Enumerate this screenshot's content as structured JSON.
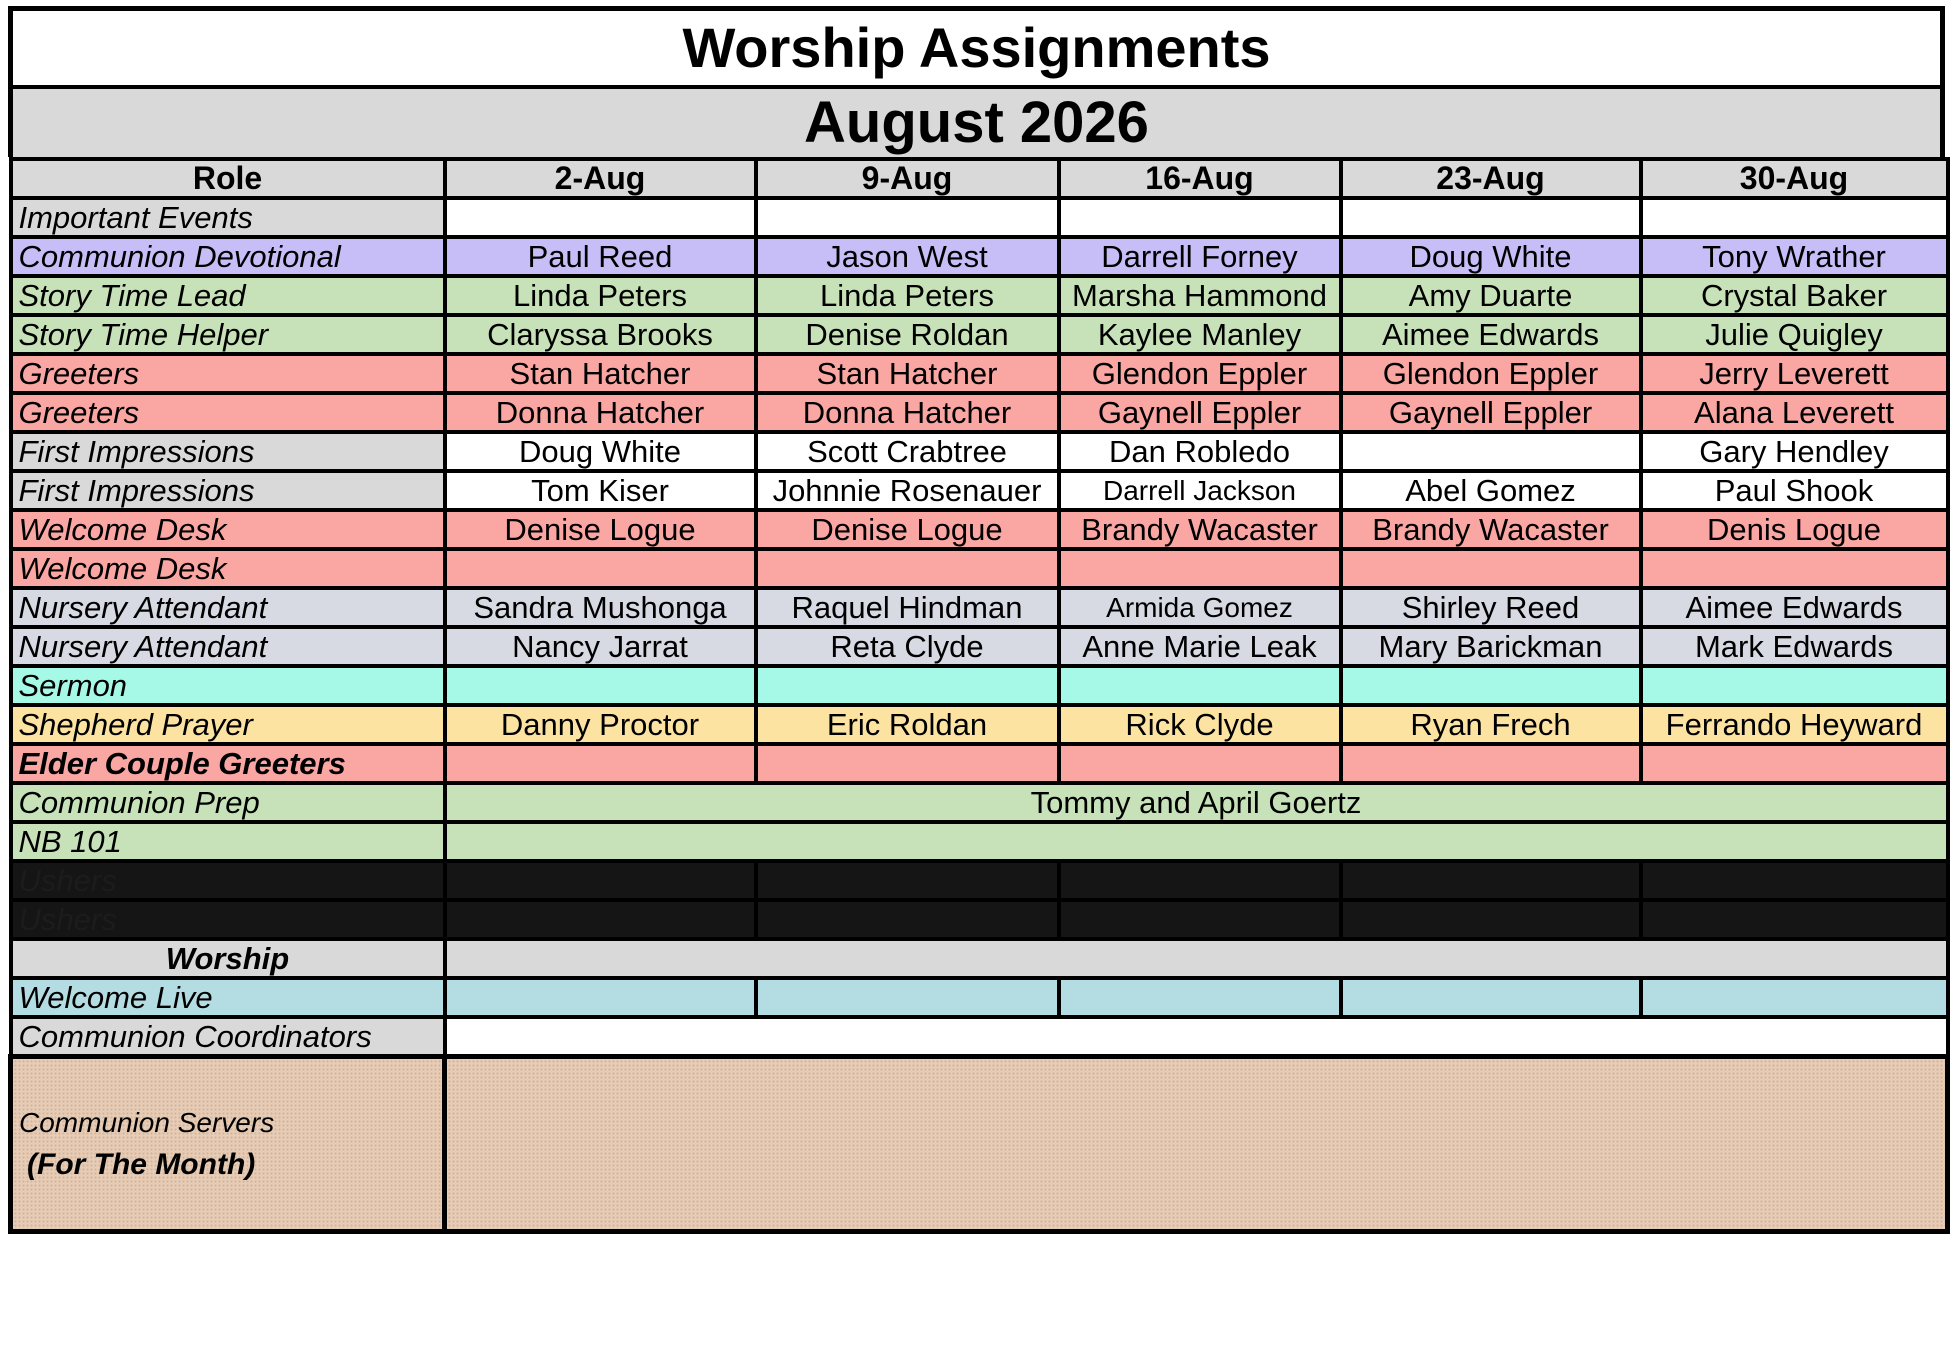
{
  "title": "Worship Assignments",
  "month": "August 2026",
  "header": {
    "role": "Role",
    "dates": [
      "2-Aug",
      "9-Aug",
      "16-Aug",
      "23-Aug",
      "30-Aug"
    ]
  },
  "rows": [
    {
      "role": "Important Events",
      "cells": [
        "",
        "",
        "",
        "",
        ""
      ]
    },
    {
      "role": "Communion Devotional",
      "cells": [
        "Paul Reed",
        "Jason West",
        "Darrell Forney",
        "Doug White",
        "Tony Wrather"
      ]
    },
    {
      "role": "Story Time Lead",
      "cells": [
        "Linda Peters",
        "Linda Peters",
        "Marsha Hammond",
        "Amy Duarte",
        "Crystal Baker"
      ]
    },
    {
      "role": "Story Time Helper",
      "cells": [
        "Claryssa Brooks",
        "Denise Roldan",
        "Kaylee Manley",
        "Aimee Edwards",
        "Julie Quigley"
      ]
    },
    {
      "role": "Greeters",
      "cells": [
        "Stan Hatcher",
        "Stan Hatcher",
        "Glendon Eppler",
        "Glendon Eppler",
        "Jerry Leverett"
      ]
    },
    {
      "role": "Greeters",
      "cells": [
        "Donna Hatcher",
        "Donna Hatcher",
        "Gaynell Eppler",
        "Gaynell Eppler",
        "Alana Leverett"
      ]
    },
    {
      "role": "First Impressions",
      "cells": [
        "Doug White",
        "Scott Crabtree",
        "Dan Robledo",
        "",
        "Gary Hendley"
      ]
    },
    {
      "role": "First Impressions",
      "cells": [
        "Tom Kiser",
        "Johnnie Rosenauer",
        "Darrell Jackson",
        "Abel Gomez",
        "Paul Shook"
      ]
    },
    {
      "role": "Welcome Desk",
      "cells": [
        "Denise Logue",
        "Denise Logue",
        "Brandy Wacaster",
        "Brandy Wacaster",
        "Denis Logue"
      ]
    },
    {
      "role": "Welcome Desk",
      "cells": [
        "",
        "",
        "",
        "",
        ""
      ]
    },
    {
      "role": "Nursery Attendant",
      "cells": [
        "Sandra Mushonga",
        "Raquel Hindman",
        "Armida Gomez",
        "Shirley Reed",
        "Aimee Edwards"
      ]
    },
    {
      "role": "Nursery Attendant",
      "cells": [
        "Nancy Jarrat",
        "Reta Clyde",
        "Anne Marie Leak",
        "Mary Barickman",
        "Mark Edwards"
      ]
    },
    {
      "role": "Sermon",
      "cells": [
        "",
        "",
        "",
        "",
        ""
      ]
    },
    {
      "role": "Shepherd Prayer",
      "cells": [
        "Danny Proctor",
        "Eric Roldan",
        "Rick Clyde",
        "Ryan Frech",
        "Ferrando Heyward"
      ]
    },
    {
      "role": "Elder Couple Greeters",
      "cells": [
        "",
        "",
        "",
        "",
        ""
      ]
    }
  ],
  "communion_prep": {
    "role": "Communion Prep",
    "value": "Tommy and April Goertz"
  },
  "nb101": {
    "role": "NB 101",
    "value": ""
  },
  "ushers": [
    {
      "role": "Ushers"
    },
    {
      "role": "Ushers"
    }
  ],
  "worship_section": "Worship",
  "welcome_live": {
    "role": "Welcome Live"
  },
  "communion_coordinators": {
    "role": "Communion Coordinators",
    "value": ""
  },
  "communion_servers": {
    "label": "Communion Servers",
    "sub": "(For The Month)",
    "value": ""
  },
  "colors": {
    "purple": "#c7bdf7",
    "green": "#c7e2b8",
    "pink": "#faa6a3",
    "lavender_gray": "#d7d9e3",
    "cyan": "#a6f8e7",
    "yellow": "#fce3a1",
    "light_blue": "#b3dde3",
    "gray": "#d9d9d9",
    "tan": "#e7cdb7"
  }
}
